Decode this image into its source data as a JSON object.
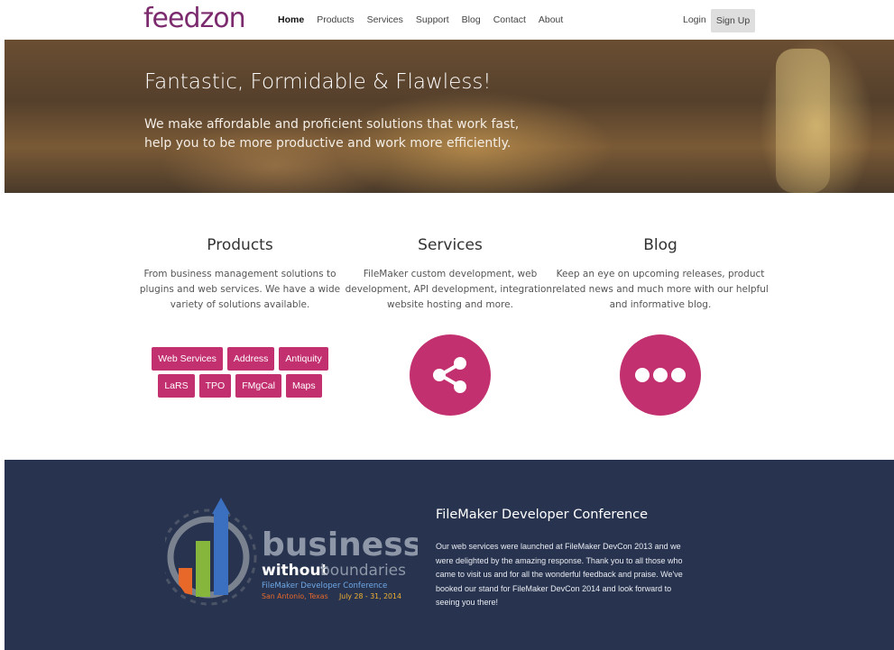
{
  "nav": {
    "logo": "feedzon",
    "links": [
      "Home",
      "Products",
      "Services",
      "Support",
      "Blog",
      "Contact",
      "About"
    ],
    "login": "Login",
    "signup": "Sign Up"
  },
  "hero": {
    "title": "Fantastic, Formidable & Flawless!",
    "subtitle": "We make affordable and proficient solutions that work fast, help you to be more productive and work more efficiently."
  },
  "columns": [
    {
      "title": "Products",
      "text": "From business management solutions to plugins and web services. We have a wide variety of solutions available."
    },
    {
      "title": "Services",
      "text": "FileMaker custom development, web development, API development, integration, website hosting and more."
    },
    {
      "title": "Blog",
      "text": "Keep an eye on upcoming releases, product related news and much more with our helpful and informative blog."
    }
  ],
  "product_tags": [
    [
      "Web Services",
      "Address",
      "Antiquity"
    ],
    [
      "LaRS",
      "TPO",
      "FMgCal",
      "Maps"
    ]
  ],
  "icons": {
    "services": "share-icon",
    "blog": "more-dots-icon"
  },
  "colors": {
    "accent": "#c2306f",
    "band": "#28344f",
    "logo": "#7b2a6e"
  },
  "conference": {
    "logo_lines": {
      "word1": "business",
      "word2a": "without",
      "word2b": "boundaries",
      "line3": "FileMaker Developer Conference",
      "line4a": "San Antonio, Texas",
      "line4b": "July 28 - 31, 2014"
    },
    "title": "FileMaker Developer Conference",
    "text": "Our web services were launched at FileMaker DevCon 2013 and we were delighted by the amazing response. Thank you to all those who came to visit us and for all the wonderful feedback and praise. We've booked our stand for FileMaker DevCon 2014 and look forward to seeing you there!"
  }
}
